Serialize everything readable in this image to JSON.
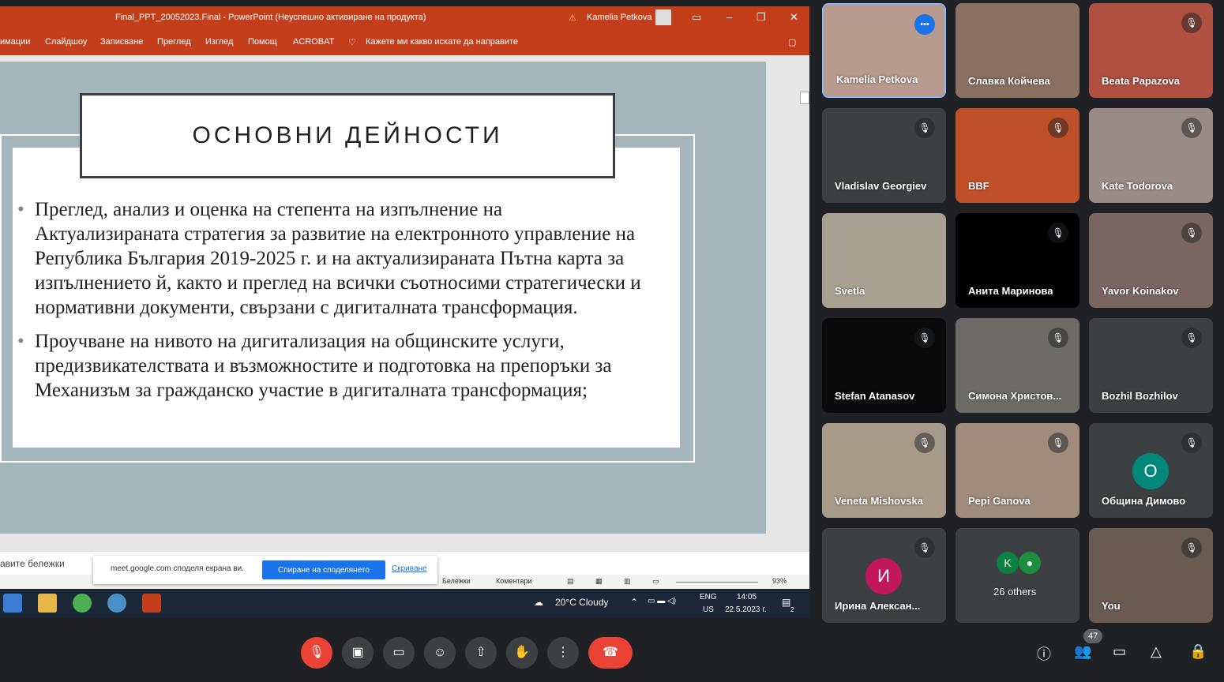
{
  "powerpoint": {
    "window_title": "Final_PPT_20052023.Final  -  PowerPoint (Неуспешно активиране на продукта)",
    "user_name": "Kamelia Petkova",
    "ribbon_tabs": [
      "имации",
      "Слайдшоу",
      "Записване",
      "Преглед",
      "Изглед",
      "Помощ",
      "ACROBAT"
    ],
    "tell_me": "Кажете ми какво искате да направите",
    "slide_title": "ОСНОВНИ ДЕЙНОСТИ",
    "bullets": [
      "Преглед, анализ и оценка на степента на изпълнение на Актуализираната стратегия за развитие на електронното управление на Република България 2019-2025 г. и на актуализираната Пътна карта за изпълнението й, както и преглед на всички съотносими стратегически и нормативни документи, свързани с дигиталната трансформация.",
      "Проучване на нивото на дигитализация на общинските услуги, предизвикателствата и възможностите и подготовка на препоръки за Механизъм за гражданско участие в дигиталната трансформация;"
    ],
    "notes_placeholder": "авите бележки",
    "status_notes": "Бележки",
    "status_comments": "Коментари",
    "zoom": "93%"
  },
  "share_bar": {
    "message": "meet.google.com споделя екрана ви.",
    "stop_button": "Спиране на споделянето",
    "hide_link": "Скриване"
  },
  "taskbar": {
    "weather": "20°C  Cloudy",
    "lang_1": "ENG",
    "lang_2": "US",
    "time": "14:05",
    "date": "22.5.2023 г.",
    "notifications": "2"
  },
  "participants": [
    {
      "name": "Kamelia Petkova",
      "state": "speaking",
      "color": "#b89a8e"
    },
    {
      "name": "Славка Койчева",
      "state": "none",
      "color": "#8a7060"
    },
    {
      "name": "Beata Papazova",
      "state": "muted",
      "color": "#b05040"
    },
    {
      "name": "Vladislav Georgiev",
      "state": "muted",
      "color": "#3c4043"
    },
    {
      "name": "BBF",
      "state": "muted",
      "color": "#c0502a"
    },
    {
      "name": "Kate Todorova",
      "state": "muted",
      "color": "#9a8c84"
    },
    {
      "name": "Svetla",
      "state": "none",
      "color": "#a8a090"
    },
    {
      "name": "Анита Маринова",
      "state": "muted",
      "color": "#000000"
    },
    {
      "name": "Yavor Koinakov",
      "state": "muted",
      "color": "#7a6660"
    },
    {
      "name": "Stefan Atanasov",
      "state": "muted",
      "color": "#0a0a0a"
    },
    {
      "name": "Симона Христов...",
      "state": "muted",
      "color": "#6c6a66"
    },
    {
      "name": "Bozhil Bozhilov",
      "state": "muted",
      "color": "#3c4043"
    },
    {
      "name": "Veneta Mishovska",
      "state": "muted",
      "color": "#a89a88"
    },
    {
      "name": "Pepi Ganova",
      "state": "muted",
      "color": "#a08c7c"
    },
    {
      "name": "Община Димово",
      "state": "muted",
      "color": "#3c4043"
    },
    {
      "name": "Ирина Алексан...",
      "state": "muted",
      "color": "#3c4043"
    },
    {
      "name": "26 others",
      "state": "none",
      "color": "#3c4043"
    },
    {
      "name": "You",
      "state": "muted",
      "color": "#6a5a50"
    }
  ],
  "avatars": {
    "obshtina": "О",
    "irina": "И",
    "others_k": "K"
  },
  "people_count": "47",
  "colors": {
    "accent": "#1a73e8",
    "end_call": "#ea4335",
    "powerpoint": "#c43e1c"
  }
}
